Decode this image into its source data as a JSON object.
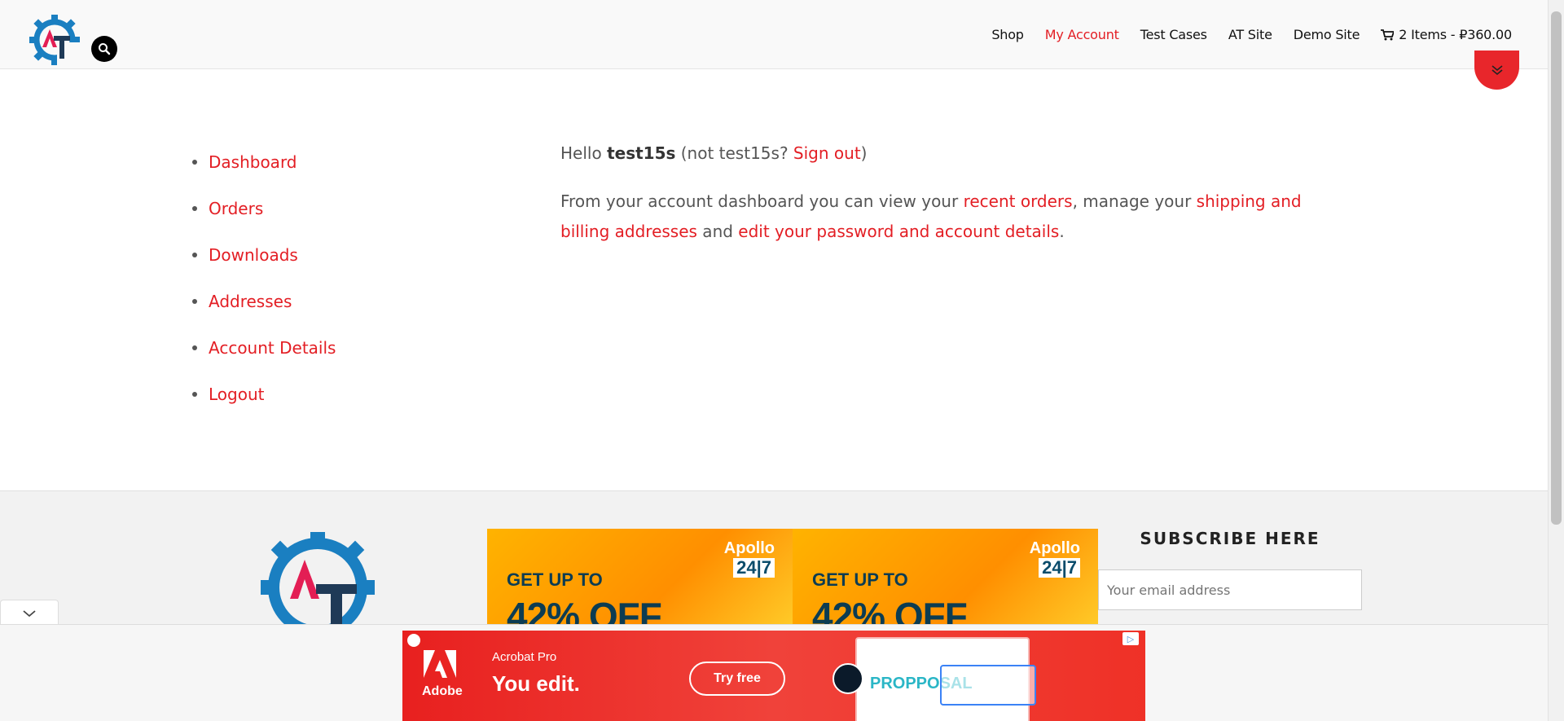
{
  "header": {
    "nav": [
      {
        "label": "Shop",
        "active": false
      },
      {
        "label": "My Account",
        "active": true
      },
      {
        "label": "Test Cases",
        "active": false
      },
      {
        "label": "AT Site",
        "active": false
      },
      {
        "label": "Demo Site",
        "active": false
      }
    ],
    "cart_label": "2 Items - ₽360.00"
  },
  "account": {
    "menu": [
      "Dashboard",
      "Orders",
      "Downloads",
      "Addresses",
      "Account Details",
      "Logout"
    ],
    "hello_prefix": "Hello ",
    "username": "test15s",
    "not_prefix": " (not test15s? ",
    "signout": "Sign out",
    "not_suffix": ")",
    "intro_1": "From your account dashboard you can view your ",
    "link_orders": "recent orders",
    "intro_2": ", manage your ",
    "link_addresses": "shipping and billing addresses",
    "intro_3": " and ",
    "link_password": "edit your password and account details",
    "intro_4": "."
  },
  "footer": {
    "banner": {
      "brand": "Apollo",
      "brand_sub": "24|7",
      "line1": "GET UP TO",
      "line2": "42% OFF"
    },
    "subscribe_title": "SUBSCRIBE HERE",
    "subscribe_placeholder": "Your email address"
  },
  "ad": {
    "brand": "Adobe",
    "product": "Acrobat Pro",
    "tagline": "You edit.",
    "cta": "Try free",
    "doc_title": "PROPPOSAL"
  },
  "colors": {
    "accent": "#e31e24",
    "logo_blue": "#1a7fc1",
    "logo_navy": "#1f3a57"
  }
}
